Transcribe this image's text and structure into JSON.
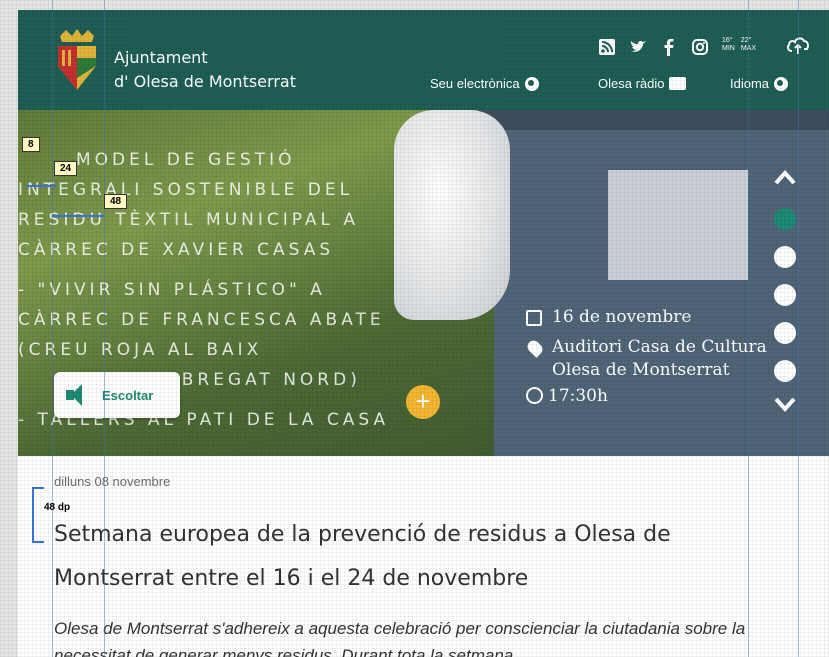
{
  "header": {
    "brand_line1": "Ajuntament",
    "brand_line2": "d' Olesa de Montserrat",
    "social_icons": [
      "rss-icon",
      "twitter-icon",
      "facebook-icon",
      "instagram-icon"
    ],
    "weather": {
      "min": "16°",
      "min_label": "MIN",
      "max": "22°",
      "max_label": "MAX"
    },
    "nav": {
      "seu": "Seu electrònica",
      "radio": "Olesa ràdio",
      "idioma": "Idioma"
    },
    "colors": {
      "header_bg": "#1f5e54",
      "accent": "#1d8a72"
    }
  },
  "hero": {
    "overlay_lines": [
      "MODEL DE GESTIÓ",
      "INTEGRALI SOSTENIBLE DEL",
      "RESIDU TÈXTIL MUNICIPAL A",
      "CÀRREC DE XAVIER CASAS",
      "",
      "- \"VIVIR SIN PLÁSTICO\" A",
      "CÀRREC DE FRANCESCA ABATE",
      "(CREU ROJA AL BAIX",
      "LLOBREGAT NORD)",
      "",
      "- TALLERS AL PATI DE LA CASA"
    ],
    "event": {
      "date": "16 de novembre",
      "place1": "Auditori Casa de Cultura",
      "place2": "Olesa de Montserrat",
      "time": "17:30h"
    },
    "listen_label": "Escoltar",
    "plus_label": "+",
    "slider": {
      "up": "^",
      "down": "v",
      "active_index": 0
    }
  },
  "article": {
    "date": "dilluns 08 novembre",
    "title": "Setmana europea de la prevenció de residus a Olesa de Montserrat entre el 16 i el 24 de novembre",
    "lead": "Olesa de Montserrat s'adhereix a aquesta celebració per conscienciar la ciutadania sobre la necessitat de generar menys residus. Durant tota la setmana"
  },
  "spec": {
    "labels": [
      "8",
      "24",
      "48"
    ],
    "dp": "48 dp"
  }
}
